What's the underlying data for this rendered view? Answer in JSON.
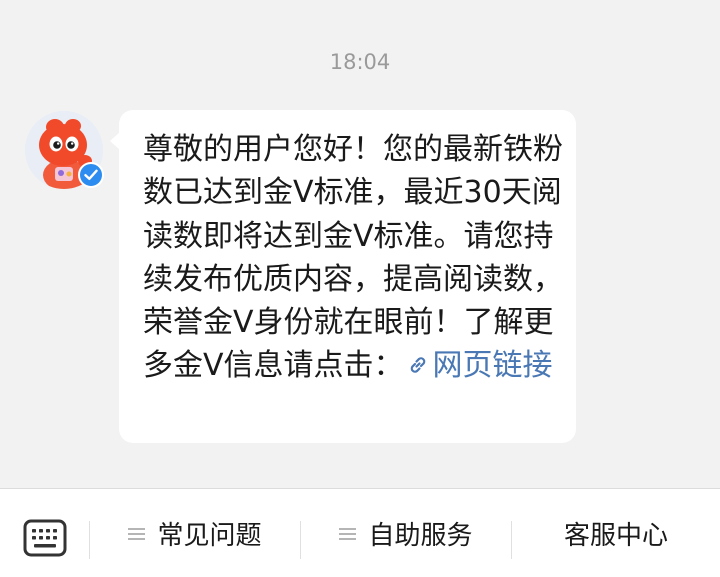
{
  "chat": {
    "timestamp": "18:04",
    "sender": {
      "avatar_icon": "mascot-avatar-icon",
      "badge_icon": "verified-check-icon",
      "badge_color": "#2d8cf0"
    },
    "message": {
      "text": "尊敬的用户您好！您的最新铁粉数已达到金V标准，最近30天阅读数即将达到金V标准。请您持续发布优质内容，提高阅读数，荣誉金V身份就在眼前！了解更多金V信息请点击：",
      "link_text": "网页链接",
      "link_icon": "link-icon",
      "link_color": "#4a78b4"
    }
  },
  "bottom_bar": {
    "keyboard_icon": "keyboard-icon",
    "menus": [
      {
        "label": "常见问题",
        "icon": "menu-lines-icon"
      },
      {
        "label": "自助服务",
        "icon": "menu-lines-icon"
      },
      {
        "label": "客服中心"
      }
    ]
  }
}
